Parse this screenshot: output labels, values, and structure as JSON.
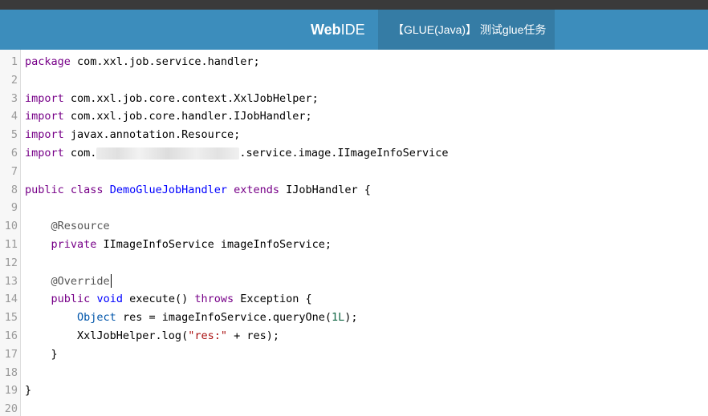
{
  "navbar": {
    "brand_bold": "Web",
    "brand_rest": "IDE",
    "task_title": "【GLUE(Java)】 测试glue任务"
  },
  "editor": {
    "line_numbers": [
      "1",
      "2",
      "3",
      "4",
      "5",
      "6",
      "7",
      "8",
      "9",
      "10",
      "11",
      "12",
      "13",
      "14",
      "15",
      "16",
      "17",
      "18",
      "19",
      "20"
    ],
    "lines": [
      [
        {
          "c": "kw",
          "t": "package"
        },
        {
          "c": "plain",
          "t": " com.xxl.job.service.handler;"
        }
      ],
      [],
      [
        {
          "c": "kw",
          "t": "import"
        },
        {
          "c": "plain",
          "t": " com.xxl.job.core.context.XxlJobHelper;"
        }
      ],
      [
        {
          "c": "kw",
          "t": "import"
        },
        {
          "c": "plain",
          "t": " com.xxl.job.core.handler.IJobHandler;"
        }
      ],
      [
        {
          "c": "kw",
          "t": "import"
        },
        {
          "c": "plain",
          "t": " javax.annotation.Resource;"
        }
      ],
      [
        {
          "c": "kw",
          "t": "import"
        },
        {
          "c": "plain",
          "t": " com."
        },
        {
          "c": "blur",
          "t": ""
        },
        {
          "c": "plain",
          "t": ".service.image.IImageInfoService"
        }
      ],
      [],
      [
        {
          "c": "kw",
          "t": "public class"
        },
        {
          "c": "plain",
          "t": " "
        },
        {
          "c": "def",
          "t": "DemoGlueJobHandler"
        },
        {
          "c": "plain",
          "t": " "
        },
        {
          "c": "kw",
          "t": "extends"
        },
        {
          "c": "plain",
          "t": " IJobHandler {"
        }
      ],
      [],
      [
        {
          "c": "plain",
          "t": "    "
        },
        {
          "c": "meta",
          "t": "@Resource"
        }
      ],
      [
        {
          "c": "plain",
          "t": "    "
        },
        {
          "c": "kw",
          "t": "private"
        },
        {
          "c": "plain",
          "t": " IImageInfoService imageInfoService;"
        }
      ],
      [],
      [
        {
          "c": "plain",
          "t": "    "
        },
        {
          "c": "meta",
          "t": "@Override"
        },
        {
          "c": "cursor",
          "t": ""
        }
      ],
      [
        {
          "c": "plain",
          "t": "    "
        },
        {
          "c": "kw",
          "t": "public"
        },
        {
          "c": "plain",
          "t": " "
        },
        {
          "c": "def",
          "t": "void"
        },
        {
          "c": "plain",
          "t": " execute() "
        },
        {
          "c": "kw",
          "t": "throws"
        },
        {
          "c": "plain",
          "t": " Exception {"
        }
      ],
      [
        {
          "c": "plain",
          "t": "        "
        },
        {
          "c": "var",
          "t": "Object"
        },
        {
          "c": "plain",
          "t": " res = imageInfoService.queryOne("
        },
        {
          "c": "num",
          "t": "1L"
        },
        {
          "c": "plain",
          "t": ");"
        }
      ],
      [
        {
          "c": "plain",
          "t": "        XxlJobHelper.log("
        },
        {
          "c": "str",
          "t": "\"res:\""
        },
        {
          "c": "plain",
          "t": " + res);"
        }
      ],
      [
        {
          "c": "plain",
          "t": "    }"
        }
      ],
      [],
      [
        {
          "c": "plain",
          "t": "}"
        }
      ],
      []
    ]
  }
}
